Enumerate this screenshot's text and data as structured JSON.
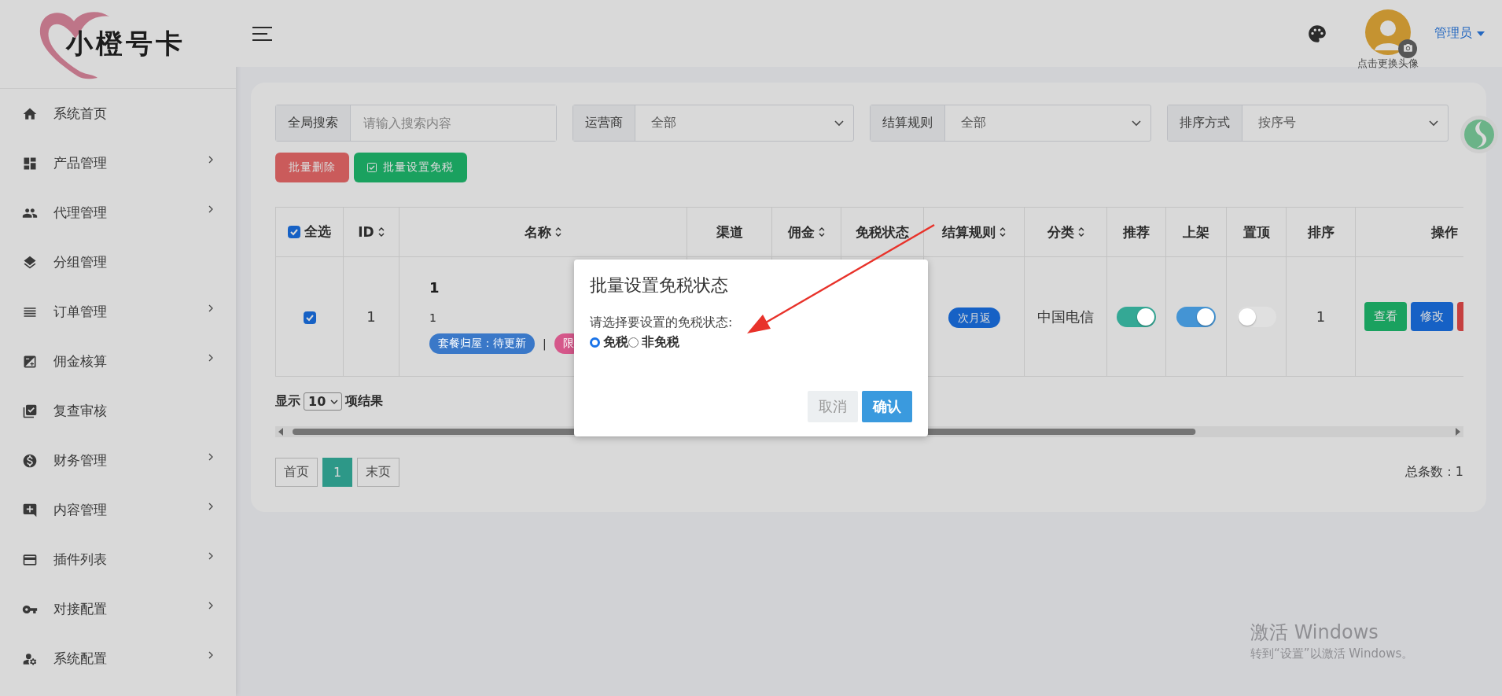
{
  "logo": {
    "text": "小橙号卡"
  },
  "sidebar": {
    "items": [
      {
        "label": "系统首页",
        "expandable": false
      },
      {
        "label": "产品管理",
        "expandable": true
      },
      {
        "label": "代理管理",
        "expandable": true
      },
      {
        "label": "分组管理",
        "expandable": false
      },
      {
        "label": "订单管理",
        "expandable": true
      },
      {
        "label": "佣金核算",
        "expandable": true
      },
      {
        "label": "复查审核",
        "expandable": false
      },
      {
        "label": "财务管理",
        "expandable": true
      },
      {
        "label": "内容管理",
        "expandable": true
      },
      {
        "label": "插件列表",
        "expandable": true
      },
      {
        "label": "对接配置",
        "expandable": true
      },
      {
        "label": "系统配置",
        "expandable": true
      }
    ]
  },
  "header": {
    "avatar_caption": "点击更换头像",
    "user": "管理员"
  },
  "filters": [
    {
      "label": "全局搜索",
      "kind": "input",
      "placeholder": "请输入搜索内容"
    },
    {
      "label": "运营商",
      "kind": "select",
      "value": "全部"
    },
    {
      "label": "结算规则",
      "kind": "select",
      "value": "全部"
    },
    {
      "label": "排序方式",
      "kind": "select",
      "value": "按序号"
    }
  ],
  "actions": [
    {
      "label": "批量删除",
      "kind": "danger"
    },
    {
      "label": "批量设置免税",
      "kind": "success"
    }
  ],
  "table": {
    "columns": [
      {
        "label": "全选",
        "kind": "checkbox",
        "checked": true,
        "sortable": false
      },
      {
        "label": "ID",
        "kind": "text",
        "sortable": true
      },
      {
        "label": "名称",
        "kind": "text",
        "sortable": true
      },
      {
        "label": "渠道",
        "kind": "text",
        "sortable": false
      },
      {
        "label": "佣金",
        "kind": "text",
        "sortable": true
      },
      {
        "label": "免税状态",
        "kind": "text",
        "sortable": false
      },
      {
        "label": "结算规则",
        "kind": "text",
        "sortable": true
      },
      {
        "label": "分类",
        "kind": "text",
        "sortable": true
      },
      {
        "label": "推荐",
        "kind": "text",
        "sortable": false
      },
      {
        "label": "上架",
        "kind": "text",
        "sortable": false
      },
      {
        "label": "置顶",
        "kind": "text",
        "sortable": false
      },
      {
        "label": "排序",
        "kind": "text",
        "sortable": false
      },
      {
        "label": "操作",
        "kind": "text",
        "sortable": false
      }
    ],
    "rows": [
      {
        "checked": true,
        "id": "1",
        "name": {
          "title": "1",
          "subtitle": "1",
          "separator": "|",
          "tags": [
            {
              "text": "套餐归屋：待更新",
              "color": "#3a78c8"
            },
            {
              "text": "限",
              "color": "#d5578a"
            }
          ]
        },
        "settlement": "次月返",
        "category": "中国电信",
        "toggles": [
          {
            "on": true,
            "color": "#34a895"
          },
          {
            "on": true,
            "color": "#4494d4"
          },
          {
            "on": false
          }
        ],
        "sort": "1",
        "operations": [
          {
            "label": "查看",
            "kind": "success"
          },
          {
            "label": "修改",
            "kind": "primary"
          },
          {
            "kind": "danger"
          }
        ]
      }
    ]
  },
  "page_length": {
    "prefix": "显示",
    "value": "10",
    "suffix": "项结果"
  },
  "pagination": [
    {
      "label": "首页",
      "selected": false
    },
    {
      "label": "1",
      "selected": true
    },
    {
      "label": "末页",
      "selected": false
    }
  ],
  "total": "总条数：1",
  "modal": {
    "title": "批量设置免税状态",
    "prompt": "请选择要设置的免税状态:",
    "options": [
      {
        "label": "免税",
        "selected": true
      },
      {
        "label": "非免税",
        "selected": false
      }
    ],
    "buttons": [
      {
        "label": "取消",
        "kind": "secondary"
      },
      {
        "label": "确认",
        "kind": "primary"
      }
    ]
  },
  "os_notice": {
    "title": "激活 Windows",
    "subtitle": "转到“设置”以激活 Windows。"
  }
}
